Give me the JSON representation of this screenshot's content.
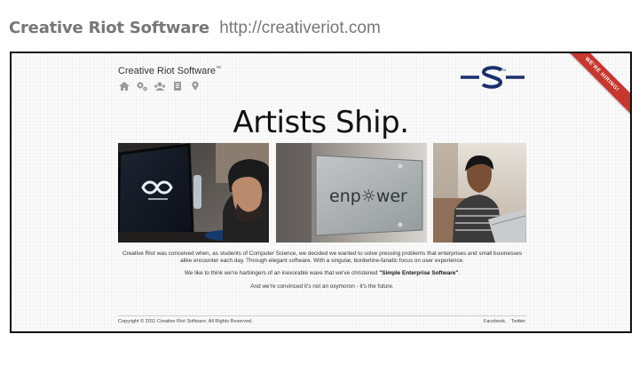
{
  "caption": {
    "brand": "Creative Riot Software",
    "url": "http://creativeriot.com"
  },
  "site": {
    "title": "Creative Riot Software",
    "title_mark": "™",
    "nav_icons": [
      "home-icon",
      "settings-icon",
      "team-icon",
      "document-icon",
      "location-pin-icon"
    ],
    "logo_icon": "creative-riot-logo",
    "ribbon": "WE'RE HIRING!",
    "headline": "Artists Ship."
  },
  "photos": [
    {
      "name": "developer-at-computer"
    },
    {
      "name": "enpower-glass-sign",
      "sign_text": "enp☼wer"
    },
    {
      "name": "person-on-laptop"
    }
  ],
  "content": {
    "paragraph1": "Creative Riot was conceived when, as students of Computer Science, we decided we wanted to solve pressing problems that enterprises and small businesses alike encounter each day. Through elegant software. With a singular, borderline-fanatic focus on user experience.",
    "paragraph2_before": "We like to think we're harbingers of an inexorable wave that we've christened ",
    "paragraph2_strong": "\"Simple Enterprise Software\"",
    "paragraph2_after": ".",
    "paragraph3": "And we're convinced it's not an oxymoron - it's the future."
  },
  "footer": {
    "copyright": "Copyright © 2011 Creative Riot Software. All Rights Reserved.",
    "links": [
      "Facebook.",
      "Twitter."
    ]
  },
  "colors": {
    "ribbon": "#c8372d",
    "logo": "#1a2f6e",
    "headline": "#111111"
  }
}
